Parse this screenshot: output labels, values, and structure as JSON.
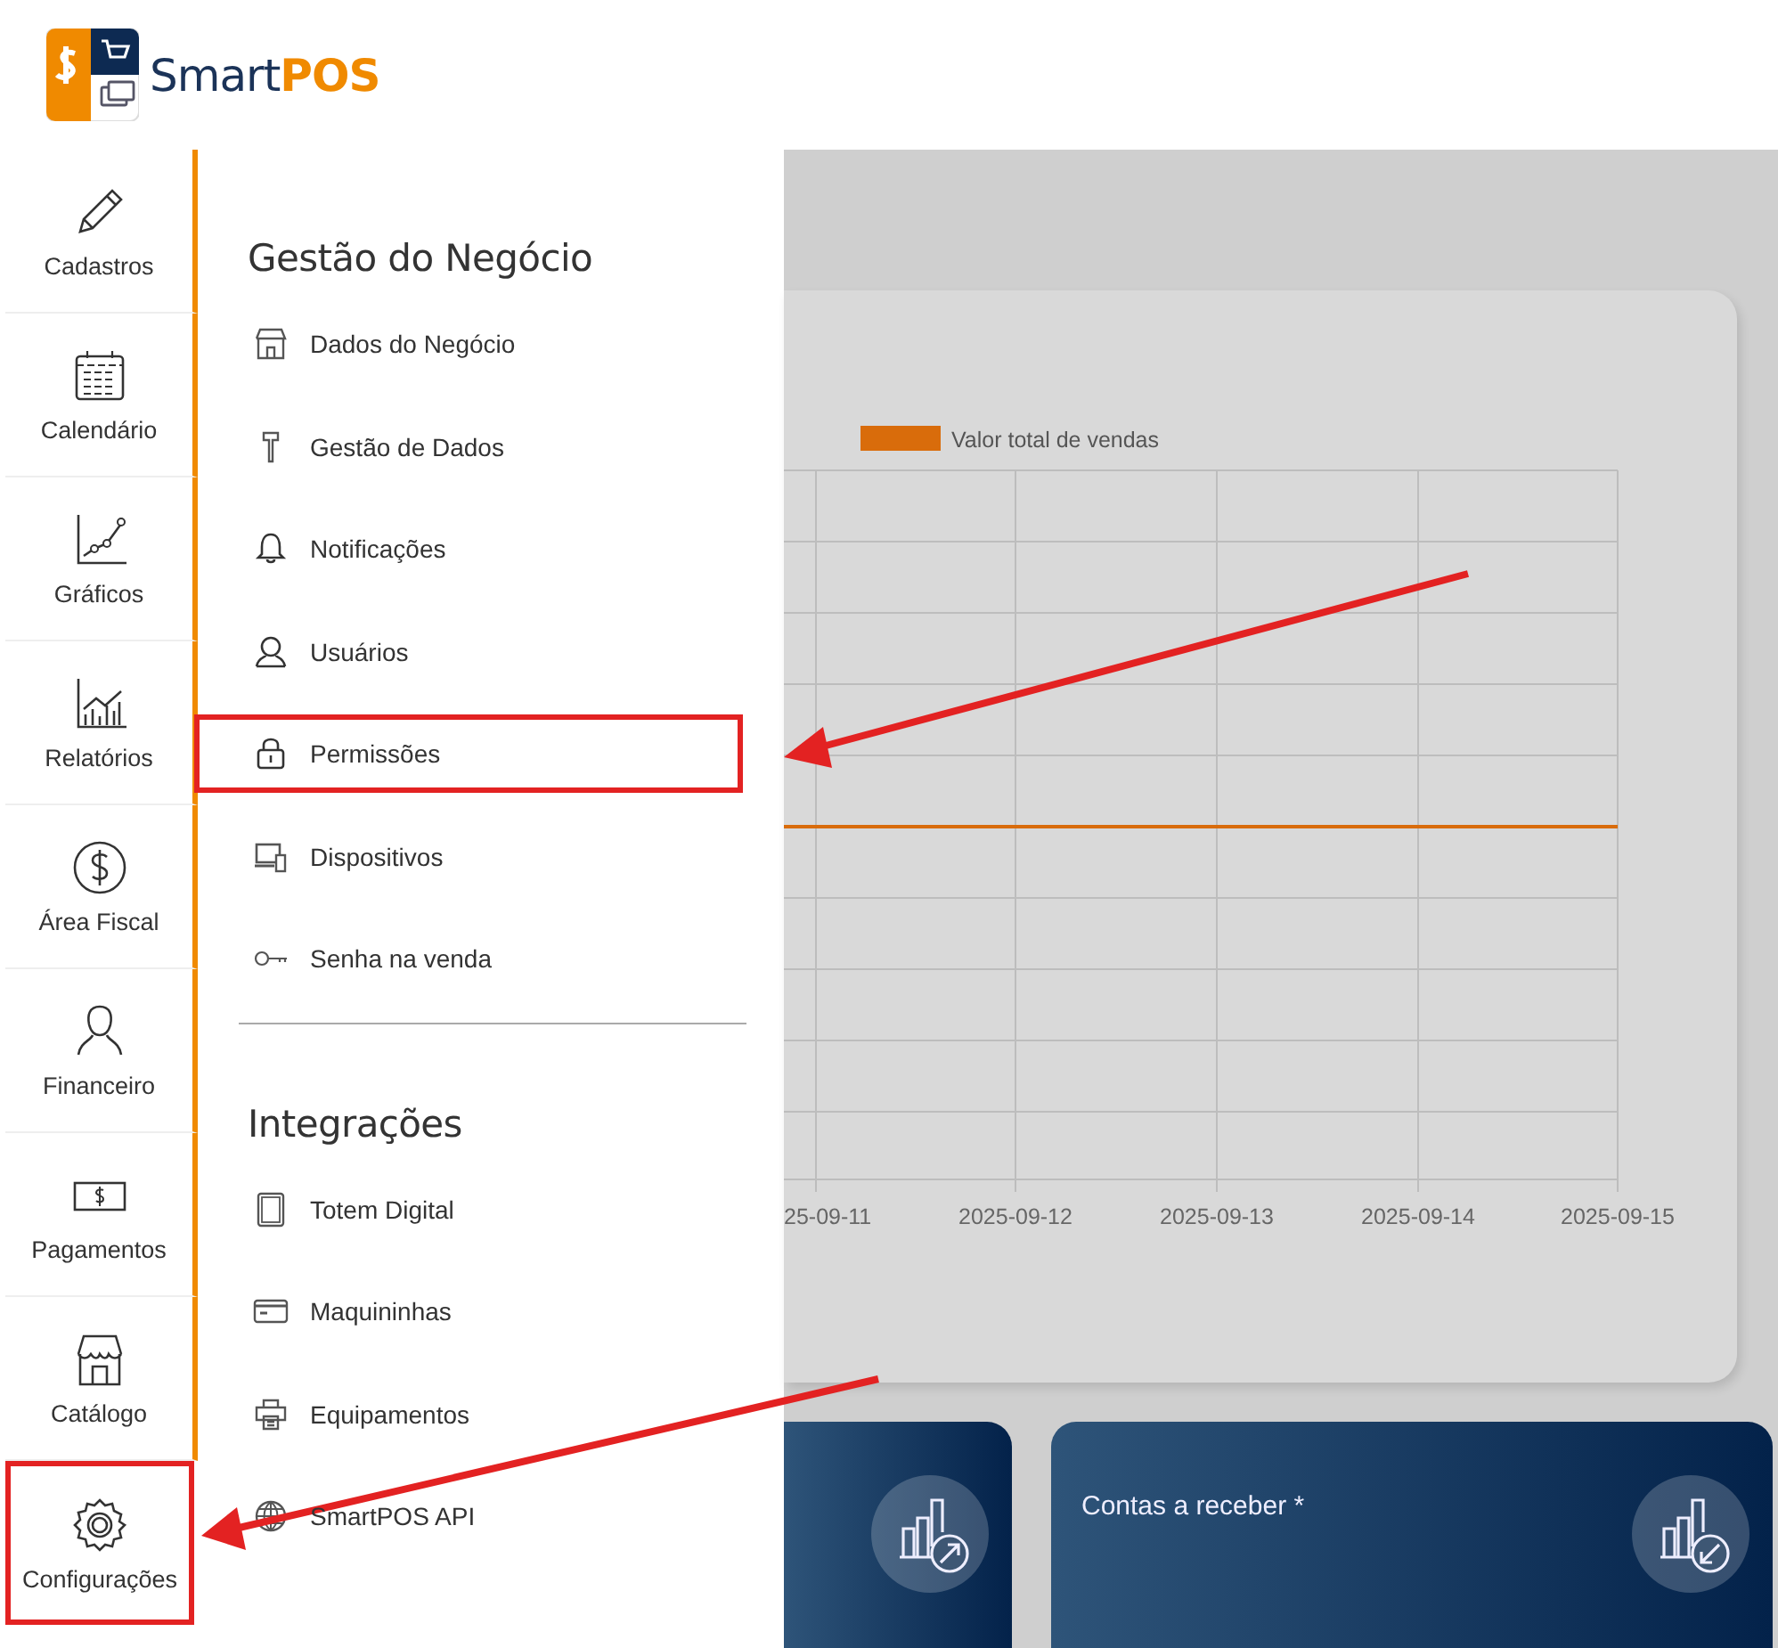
{
  "header": {
    "logo_text": "Smart**POS**"
  },
  "sidebar": {
    "items": [
      {
        "label": "Cadastros",
        "selected": false
      },
      {
        "label": "Calendário",
        "selected": false
      },
      {
        "label": "Gráficos",
        "selected": false
      },
      {
        "label": "Relatórios",
        "selected": false
      },
      {
        "label": "Área Fiscal",
        "selected": false
      },
      {
        "label": "Financeiro",
        "selected": false
      },
      {
        "label": "Pagamentos",
        "selected": false
      },
      {
        "label": "Catálogo",
        "selected": false
      },
      {
        "label": "Configurações",
        "selected": true
      }
    ]
  },
  "menu_panel": {
    "sections": [
      {
        "title": "Gestão do Negócio",
        "items": [
          {
            "label": "Dados do Negócio",
            "selected": false
          },
          {
            "label": "Gestão de Dados",
            "selected": false
          },
          {
            "label": "Notificações",
            "selected": false
          },
          {
            "label": "Usuários",
            "selected": false
          },
          {
            "label": "Permissões",
            "selected": true
          },
          {
            "label": "Dispositivos",
            "selected": false
          },
          {
            "label": "Senha na venda",
            "selected": false
          }
        ]
      },
      {
        "title": "Integrações",
        "items": [
          {
            "label": "Totem Digital",
            "selected": false
          },
          {
            "label": "Maquininhas",
            "selected": false
          },
          {
            "label": "Equipamentos",
            "selected": false
          },
          {
            "label": "SmartPOS API",
            "selected": false
          }
        ]
      }
    ]
  },
  "chart_card": {
    "legend": [
      {
        "name": "Valor total de vendas",
        "color": "#d96c0b"
      }
    ],
    "x_labels": [
      "25-09-11",
      "2025-09-12",
      "2025-09-13",
      "2025-09-14",
      "2025-09-15"
    ]
  },
  "summary_cards": [
    {
      "kind": "up"
    },
    {
      "kind": "down",
      "title": "Contas a receber *"
    }
  ]
}
